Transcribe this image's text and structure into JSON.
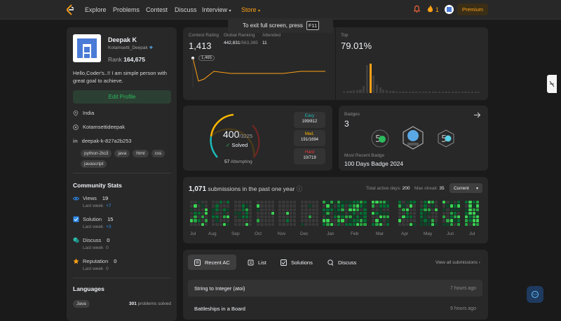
{
  "nav": {
    "items": [
      "Explore",
      "Problems",
      "Contest",
      "Discuss",
      "Interview",
      "Store"
    ],
    "streak": "1",
    "premium": "Premium"
  },
  "toast": {
    "text": "To exit full screen, press",
    "key": "F11"
  },
  "profile": {
    "name": "Deepak K",
    "handle": "Kotamsetti_Deepak",
    "rank_label": "Rank",
    "rank_value": "164,675",
    "bio": "Hello,Coder's..!! I am simple person with great goal to achieve.",
    "edit_label": "Edit Profile",
    "location": "India",
    "github": "Kotamsettideepak",
    "linkedin": "deepak-k-827a2b253",
    "tags": [
      "python-2to3",
      "java",
      "html",
      "css",
      "javascript"
    ]
  },
  "community": {
    "title": "Community Stats",
    "stats": [
      {
        "label": "Views",
        "value": "19",
        "sub": "Last week",
        "delta": "+7",
        "color": "#2d8cf0"
      },
      {
        "label": "Solution",
        "value": "15",
        "sub": "Last week",
        "delta": "+3",
        "color": "#2d8cf0"
      },
      {
        "label": "Discuss",
        "value": "0",
        "sub": "Last week",
        "delta": "0",
        "color": "#2cbbab"
      },
      {
        "label": "Reputation",
        "value": "0",
        "sub": "Last week",
        "delta": "0",
        "color": "#ffa116"
      }
    ]
  },
  "languages": {
    "title": "Languages",
    "rows": [
      {
        "name": "Java",
        "count": "301",
        "suffix": "problems solved"
      }
    ]
  },
  "contest": {
    "rating_label": "Contest Rating",
    "rating": "1,413",
    "global_label": "Global Ranking",
    "global": "442,831",
    "global_total": "/563,365",
    "attended_label": "Attended",
    "attended": "11",
    "point_label": "1,465",
    "top_label": "Top",
    "top": "79.01%"
  },
  "solved": {
    "solved": "400",
    "total": "/3225",
    "solved_label": "Solved",
    "attempting": "57",
    "attempting_label": "Attempting",
    "difficulties": [
      {
        "name": "Easy",
        "value": "199/812",
        "color": "#1cbaba"
      },
      {
        "name": "Med.",
        "value": "191/1694",
        "color": "#ffb700"
      },
      {
        "name": "Hard",
        "value": "10/719",
        "color": "#f63737"
      }
    ]
  },
  "badges": {
    "label": "Badges",
    "count": "3",
    "recent_label": "Most Recent Badge",
    "recent": "100 Days Badge 2024"
  },
  "submissions": {
    "count": "1,071",
    "text": "submissions in the past one year",
    "active_label": "Total active days:",
    "active": "200",
    "streak_label": "Max streak:",
    "streak": "35",
    "dropdown": "Current",
    "months": [
      "Jul",
      "Aug",
      "Sep",
      "Oct",
      "Nov",
      "Dec",
      "Jan",
      "Feb",
      "Mar",
      "Apr",
      "May",
      "Jun",
      "Jul"
    ]
  },
  "recent": {
    "tabs": [
      "Recent AC",
      "List",
      "Solutions",
      "Discuss"
    ],
    "view_all": "View all submissions",
    "rows": [
      {
        "title": "String to Integer (atoi)",
        "time": "7 hours ago"
      },
      {
        "title": "Battleships in a Board",
        "time": "9 hours ago"
      }
    ]
  }
}
